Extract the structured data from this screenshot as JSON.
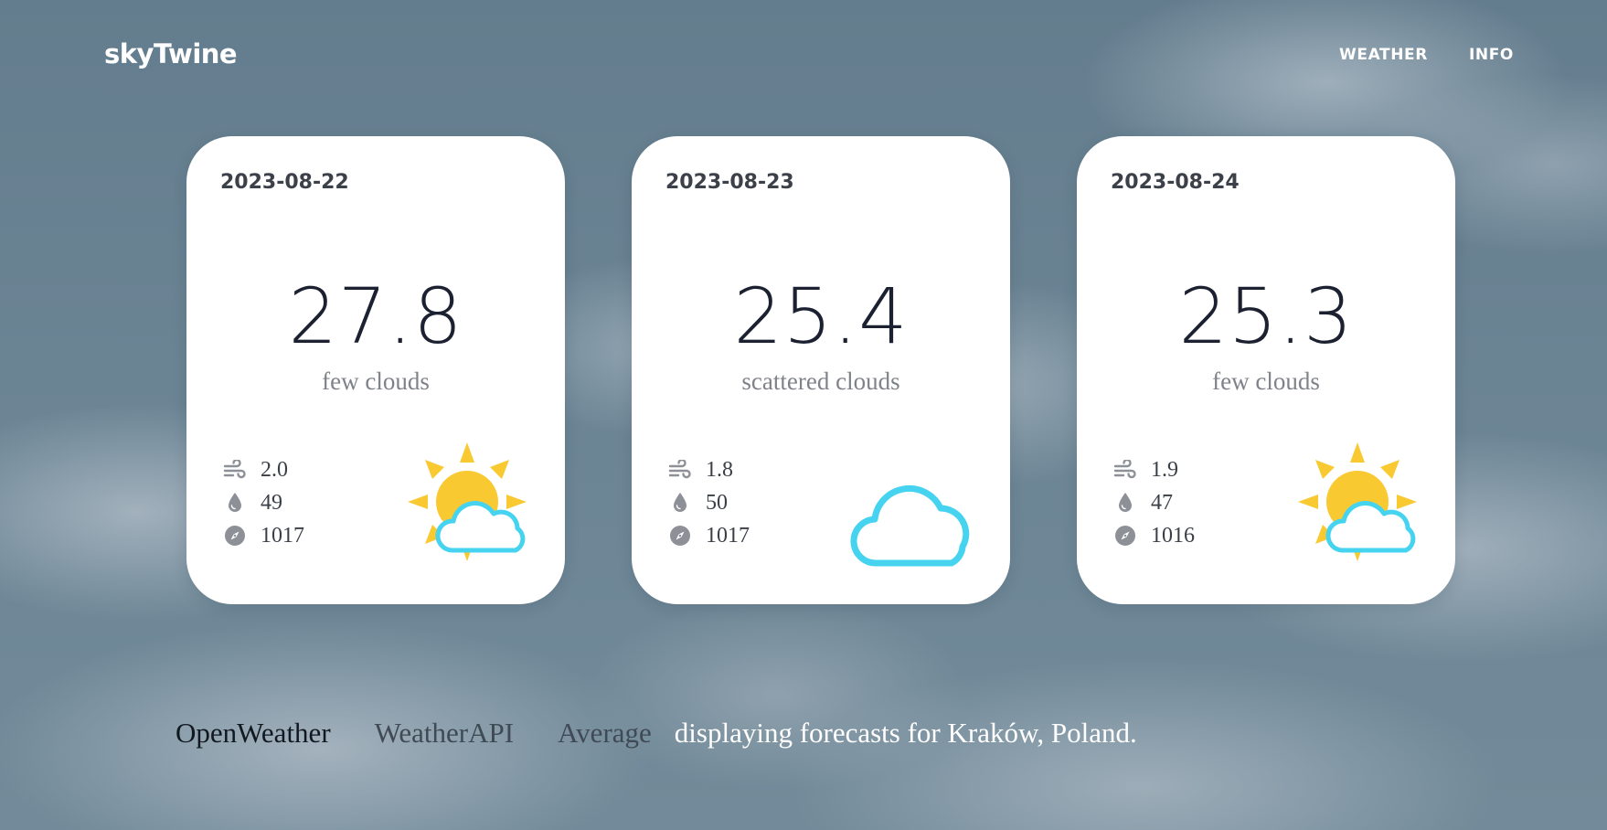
{
  "header": {
    "logo": "skyTwine",
    "nav": [
      "WEATHER",
      "INFO"
    ]
  },
  "cards": [
    {
      "date": "2023-08-22",
      "temp": "27.8",
      "desc": "few clouds",
      "wind": "2.0",
      "humidity": "49",
      "pressure": "1017",
      "icon": "sun-cloud-icon"
    },
    {
      "date": "2023-08-23",
      "temp": "25.4",
      "desc": "scattered clouds",
      "wind": "1.8",
      "humidity": "50",
      "pressure": "1017",
      "icon": "cloud-icon"
    },
    {
      "date": "2023-08-24",
      "temp": "25.3",
      "desc": "few clouds",
      "wind": "1.9",
      "humidity": "47",
      "pressure": "1016",
      "icon": "sun-cloud-icon"
    }
  ],
  "footer": {
    "sources": [
      "OpenWeather",
      "WeatherAPI",
      "Average"
    ],
    "active_source": "OpenWeather",
    "info": "displaying forecasts for Kraków, Poland."
  },
  "colors": {
    "sun": "#f9c932",
    "cloud_outline": "#45d3f0",
    "icon_gray": "#8d9097"
  }
}
